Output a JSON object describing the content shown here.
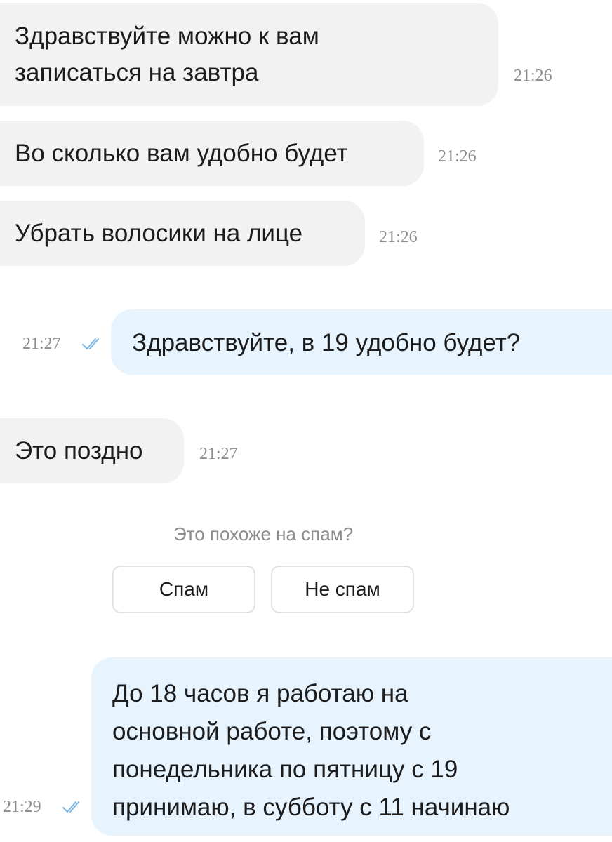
{
  "messages": [
    {
      "text_lines": [
        "Здравствуйте можно к вам",
        "записаться на завтра"
      ],
      "time": "21:26",
      "direction": "incoming"
    },
    {
      "text": "Во сколько вам удобно будет",
      "time": "21:26",
      "direction": "incoming"
    },
    {
      "text": "Убрать волосики на лице",
      "time": "21:26",
      "direction": "incoming"
    },
    {
      "text": "Здравствуйте, в 19 удобно будет?",
      "time": "21:27",
      "direction": "outgoing",
      "status_icon": "double-check-icon"
    },
    {
      "text": "Это поздно",
      "time": "21:27",
      "direction": "incoming"
    },
    {
      "text_lines": [
        "До 18 часов я работаю на",
        "основной работе, поэтому с",
        "понедельника по пятницу с 19",
        "принимаю, в субботу с 11 начинаю"
      ],
      "time": "21:29",
      "direction": "outgoing",
      "status_icon": "double-check-icon"
    }
  ],
  "spam_prompt": {
    "question": "Это похоже на спам?",
    "spam_label": "Спам",
    "not_spam_label": "Не спам"
  },
  "colors": {
    "incoming_bubble": "#f2f2f2",
    "outgoing_bubble": "#e7f3fd",
    "timestamp": "#8c8c8c",
    "read_check": "#7ab8e8"
  }
}
